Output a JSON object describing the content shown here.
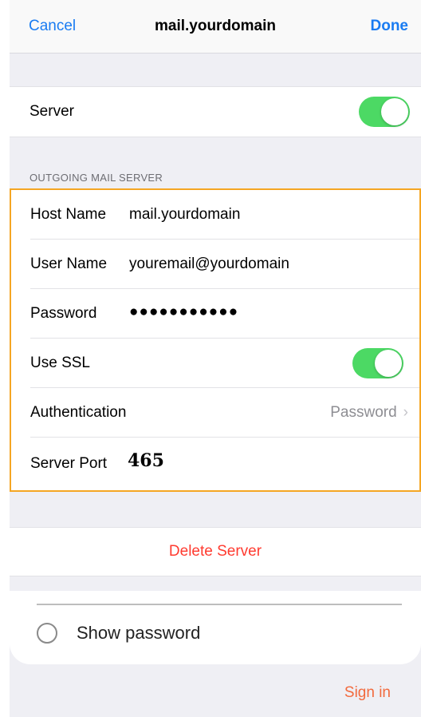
{
  "navbar": {
    "cancel": "Cancel",
    "title": "mail.yourdomain",
    "done": "Done"
  },
  "server_toggle": {
    "label": "Server",
    "on": true
  },
  "outgoing": {
    "header": "OUTGOING MAIL SERVER",
    "host_label": "Host Name",
    "host_value": "mail.yourdomain",
    "user_label": "User Name",
    "user_value": "youremail@yourdomain",
    "password_label": "Password",
    "password_value": "●●●●●●●●●●●",
    "ssl_label": "Use SSL",
    "ssl_on": true,
    "auth_label": "Authentication",
    "auth_value": "Password",
    "port_label": "Server Port",
    "port_value": "465"
  },
  "delete_label": "Delete Server",
  "android": {
    "show_password": "Show password",
    "sign_in": "Sign in"
  },
  "colors": {
    "accent_blue": "#1a7cf2",
    "toggle_green": "#4cd964",
    "destructive_red": "#ff3b30",
    "highlight_orange": "#f5a623",
    "signin_orange": "#f26a3d"
  }
}
